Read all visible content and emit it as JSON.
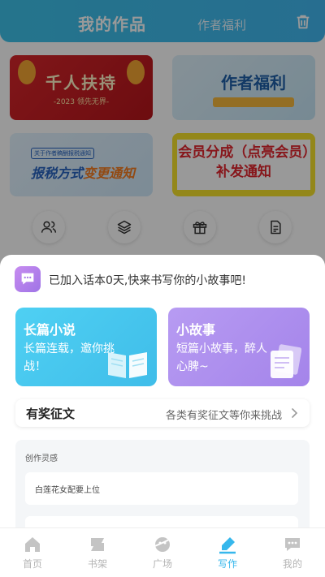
{
  "header": {
    "title": "我的作品",
    "tab_secondary": "作者福利"
  },
  "banners": {
    "b1_main": "千人扶持",
    "b1_sub": "-2023 领先无界-",
    "b2_main": "作者福利",
    "b3_tag": "关于作者稿酬报税通知",
    "b3_main_a": "报税方式",
    "b3_main_b": "变更通知",
    "b4_main": "会员分成（点亮会员）补发通知"
  },
  "quick_actions": [
    "user-group-icon",
    "layers-icon",
    "gift-icon",
    "document-icon"
  ],
  "sheet": {
    "notice": "已加入话本0天,快来书写你的小故事吧!",
    "long_card": {
      "title": "长篇小说",
      "desc": "长篇连载，邀你挑战！"
    },
    "short_card": {
      "title": "小故事",
      "desc": "短篇小故事，醉人心脾~"
    },
    "contest": {
      "title": "有奖征文",
      "subtitle": "各类有奖征文等你来挑战"
    },
    "inspiration": {
      "title": "创作灵感",
      "items": [
        "白莲花女配要上位",
        ""
      ]
    }
  },
  "nav": {
    "items": [
      {
        "label": "首页",
        "icon": "home-icon"
      },
      {
        "label": "书架",
        "icon": "bookshelf-icon"
      },
      {
        "label": "广场",
        "icon": "plaza-icon"
      },
      {
        "label": "写作",
        "icon": "write-icon"
      },
      {
        "label": "我的",
        "icon": "profile-icon"
      }
    ],
    "active_index": 3
  },
  "colors": {
    "accent": "#36b7ec",
    "long_card": "#4fd0f3",
    "short_card": "#b79bf2"
  }
}
